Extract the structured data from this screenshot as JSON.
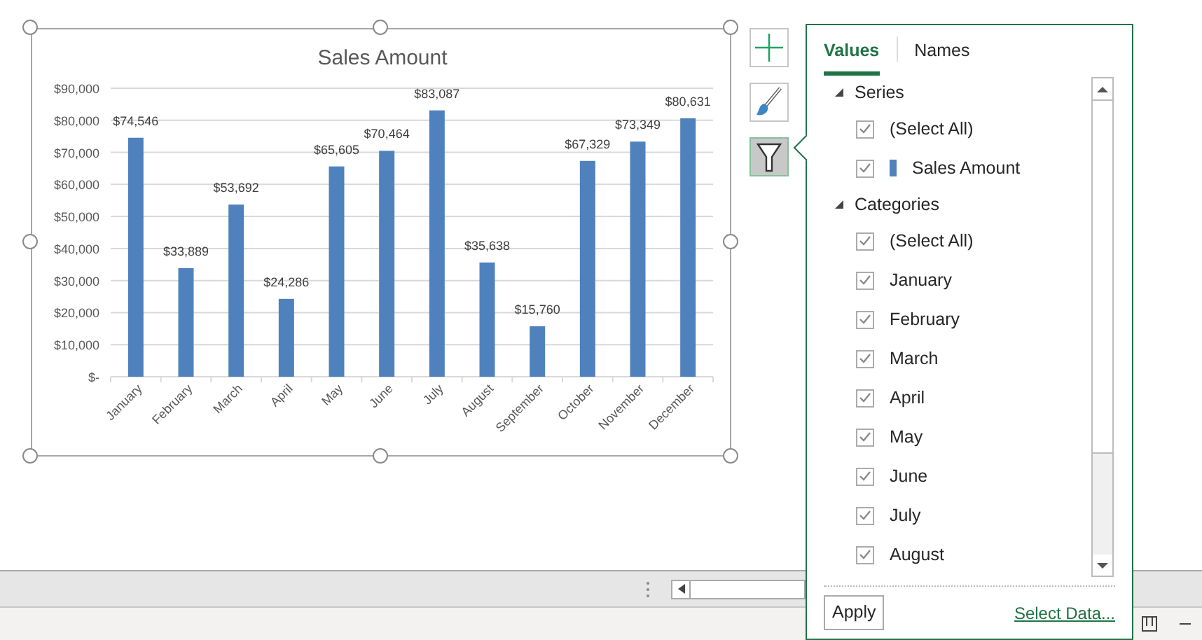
{
  "chart": {
    "chart_data": {
      "type": "bar",
      "title": "Sales Amount",
      "categories": [
        "January",
        "February",
        "March",
        "April",
        "May",
        "June",
        "July",
        "August",
        "September",
        "October",
        "November",
        "December"
      ],
      "grid": true,
      "series": [
        {
          "color": "#4f81bd",
          "values": [
            74546,
            33889,
            53692,
            24286,
            65605,
            70464,
            83087,
            35638,
            15760,
            67329,
            73349,
            80631
          ]
        }
      ],
      "value_labels": [
        "$74,546",
        "$33,889",
        "$53,692",
        "$24,286",
        "$65,605",
        "$70,464",
        "$83,087",
        "$35,638",
        "$15,760",
        "$67,329",
        "$73,349",
        "$80,631"
      ],
      "ylim": [
        0,
        90000
      ],
      "yticks": [
        {
          "value": 0,
          "label": "$-"
        },
        {
          "value": 10000,
          "label": "$10,000"
        },
        {
          "value": 20000,
          "label": "$20,000"
        },
        {
          "value": 30000,
          "label": "$30,000"
        },
        {
          "value": 40000,
          "label": "$40,000"
        },
        {
          "value": 50000,
          "label": "$50,000"
        },
        {
          "value": 60000,
          "label": "$60,000"
        },
        {
          "value": 70000,
          "label": "$70,000"
        },
        {
          "value": 80000,
          "label": "$80,000"
        },
        {
          "value": 90000,
          "label": "$90,000"
        }
      ]
    }
  },
  "chart_tools": [
    {
      "kind": "add",
      "selected": false
    },
    {
      "kind": "style",
      "selected": false
    },
    {
      "kind": "filter",
      "selected": true
    }
  ],
  "filter_panel": {
    "tabs": [
      {
        "label": "Values",
        "selected": true
      },
      {
        "label": "Names",
        "selected": false
      }
    ],
    "groups": [
      {
        "label": "Series",
        "expanded": true,
        "children": [
          {
            "label": "(Select All)",
            "checked": true
          },
          {
            "label": "Sales Amount",
            "checked": true,
            "color": "#4f81bd"
          }
        ]
      },
      {
        "label": "Categories",
        "expanded": true,
        "children": [
          {
            "label": "(Select All)",
            "checked": true
          },
          {
            "label": "January",
            "checked": true
          },
          {
            "label": "February",
            "checked": true
          },
          {
            "label": "March",
            "checked": true
          },
          {
            "label": "April",
            "checked": true
          },
          {
            "label": "May",
            "checked": true
          },
          {
            "label": "June",
            "checked": true
          },
          {
            "label": "July",
            "checked": true
          },
          {
            "label": "August",
            "checked": true
          }
        ]
      }
    ],
    "apply_button": "Apply",
    "link": "Select Data..."
  }
}
